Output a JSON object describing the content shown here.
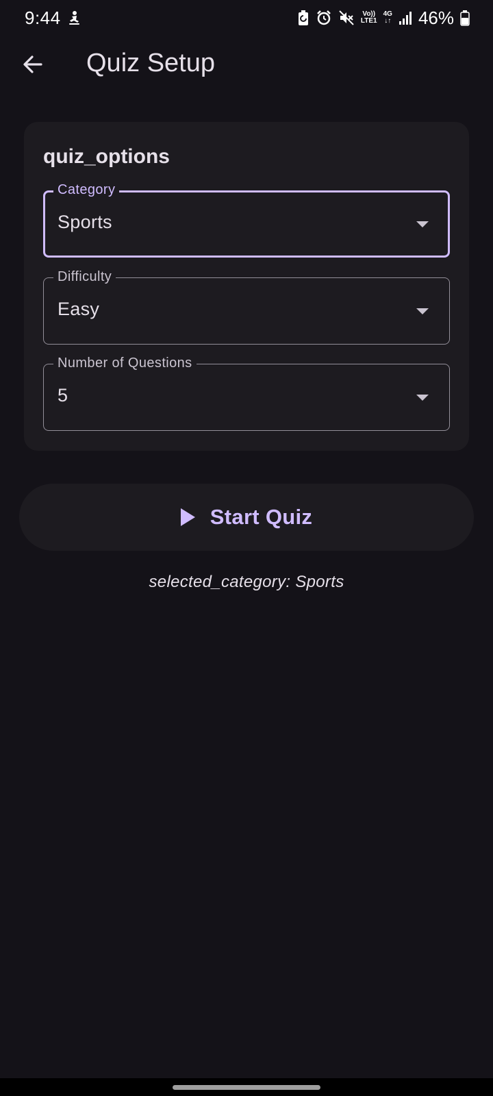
{
  "status_bar": {
    "time": "9:44",
    "battery_percent": "46%",
    "volte_label": "Vo))",
    "lte_label": "LTE1",
    "network_label": "4G",
    "icons": [
      "person-skating-icon",
      "battery-saver-icon",
      "alarm-icon",
      "mute-icon",
      "volte-icon",
      "4g-icon",
      "signal-icon",
      "battery-icon"
    ]
  },
  "app_bar": {
    "title": "Quiz Setup",
    "back_icon": "arrow-back-icon"
  },
  "card": {
    "title": "quiz_options",
    "fields": [
      {
        "label": "Category",
        "value": "Sports",
        "focused": true
      },
      {
        "label": "Difficulty",
        "value": "Easy",
        "focused": false
      },
      {
        "label": "Number of Questions",
        "value": "5",
        "focused": false
      }
    ]
  },
  "start_button": {
    "label": "Start Quiz",
    "icon": "play-icon"
  },
  "selected_category_text": "selected_category: Sports",
  "colors": {
    "background": "#141218",
    "surface": "#1D1B20",
    "primary": "#D0BCFF",
    "outline": "#938F99",
    "on_surface": "#E6E0E9"
  }
}
